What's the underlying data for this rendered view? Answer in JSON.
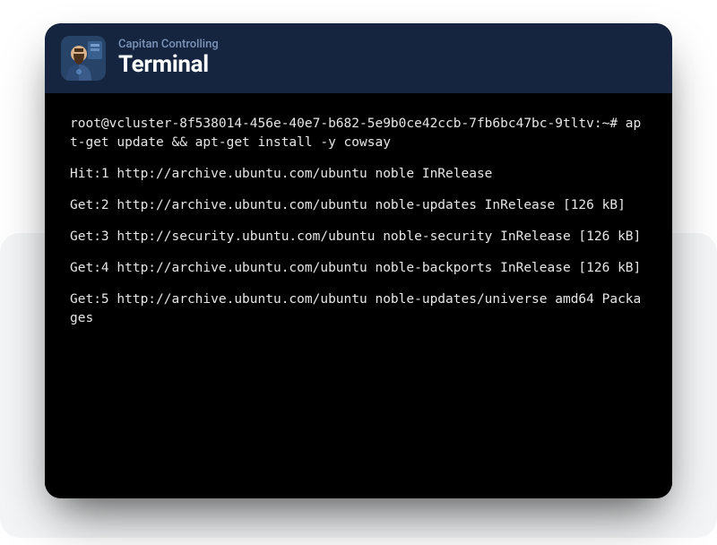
{
  "header": {
    "subtitle": "Capitan Controlling",
    "title": "Terminal"
  },
  "terminal": {
    "lines": [
      "root@vcluster-8f538014-456e-40e7-b682-5e9b0ce42ccb-7fb6bc47bc-9tltv:~# apt-get update && apt-get install -y cowsay",
      "Hit:1 http://archive.ubuntu.com/ubuntu noble InRelease",
      "Get:2 http://archive.ubuntu.com/ubuntu noble-updates InRelease [126 kB]",
      "Get:3 http://security.ubuntu.com/ubuntu noble-security InRelease [126 kB]",
      "Get:4 http://archive.ubuntu.com/ubuntu noble-backports InRelease [126 kB]",
      "Get:5 http://archive.ubuntu.com/ubuntu noble-updates/universe amd64 Packages"
    ]
  }
}
